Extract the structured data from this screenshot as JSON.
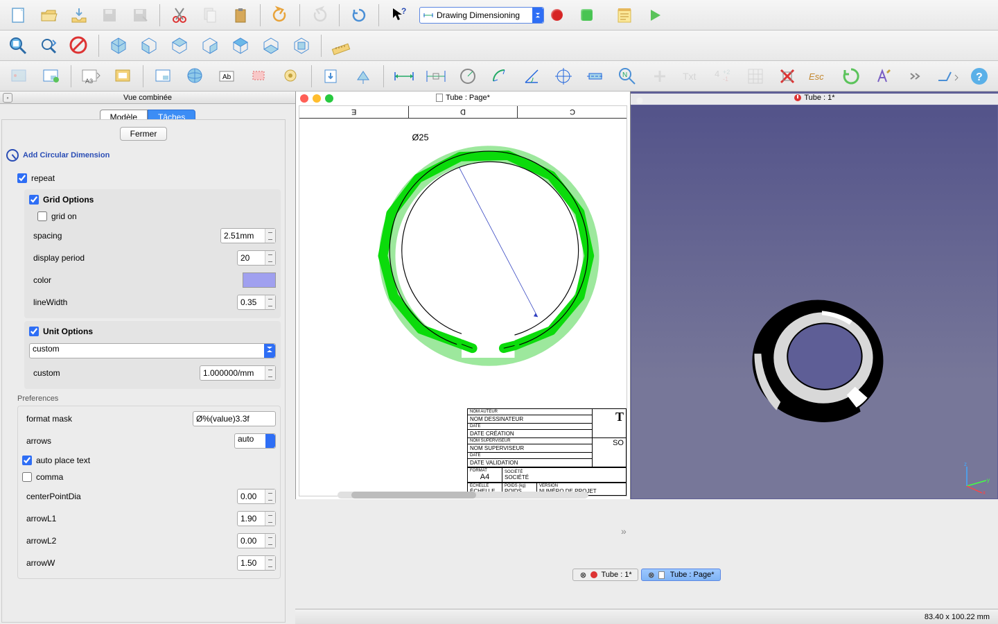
{
  "workbench": {
    "label": "Drawing Dimensioning"
  },
  "toolbar1_icons": [
    "new",
    "open",
    "save",
    "save-as",
    "print",
    "sep",
    "cut",
    "copy",
    "paste",
    "sep",
    "undo",
    "redo",
    "sep",
    "refresh",
    "sep",
    "whatsthis"
  ],
  "statusdots": [
    {
      "color": "#d62424"
    },
    {
      "color": "#48c452"
    }
  ],
  "notes_icon": true,
  "play_icon": true,
  "left_panel": {
    "title": "Vue combinée",
    "tabs": [
      "Modèle",
      "Tâches"
    ],
    "active_tab": 1,
    "close": "Fermer",
    "task_title": "Add Circular Dimension",
    "repeat_label": "repeat",
    "repeat": true,
    "grid": {
      "title": "Grid Options",
      "on_label": "grid on",
      "on": false,
      "spacing_label": "spacing",
      "spacing": "2.51mm",
      "period_label": "display period",
      "period": "20",
      "color_label": "color",
      "linewidth_label": "lineWidth",
      "linewidth": "0.35"
    },
    "unit": {
      "title": "Unit Options",
      "mode": "custom",
      "custom_label": "custom",
      "custom": "1.000000/mm"
    },
    "prefs": {
      "title": "Preferences",
      "format_label": "format mask",
      "format": "Ø%(value)3.3f",
      "arrows_label": "arrows",
      "arrows": "auto",
      "auto_place_label": "auto place text",
      "auto_place": true,
      "comma_label": "comma",
      "comma": false,
      "cpd_label": "centerPointDia",
      "cpd": "0.00",
      "a1_label": "arrowL1",
      "a1": "1.90",
      "a2_label": "arrowL2",
      "a2": "0.00",
      "aw_label": "arrowW",
      "aw": "1.50"
    }
  },
  "mid": {
    "title": "Tube : Page*",
    "ruler": [
      "E",
      "D",
      "C"
    ],
    "dim_label": "Ø25",
    "titleblock": {
      "author_k": "NOM AUTEUR",
      "author": "NOM DESSINATEUR",
      "date_k": "DATE",
      "date": "DATE CRÉATION",
      "sup_k": "NOM SUPERVISEUR",
      "sup": "NOM SUPERVISEUR",
      "valid_k": "DATE",
      "valid": "DATE VALIDATION",
      "format_k": "FORMAT",
      "format": "A4",
      "soc_k": "SOCIÉTÉ",
      "soc": "SOCIÉTÉ",
      "ech_k": "ÉCHELLE",
      "ech": "ÉCHELLE",
      "poids_k": "POIDS",
      "poids": "POIDS",
      "ver_k": "VERSION",
      "ver": "NUMÉRO DE PROJET",
      "big1": "T",
      "big2": "SO"
    }
  },
  "right": {
    "title": "Tube : 1*"
  },
  "bottom": {
    "tabs": [
      "Tube : 1*",
      "Tube : Page*"
    ],
    "active": 1
  },
  "status": "83.40 x 100.22 mm"
}
